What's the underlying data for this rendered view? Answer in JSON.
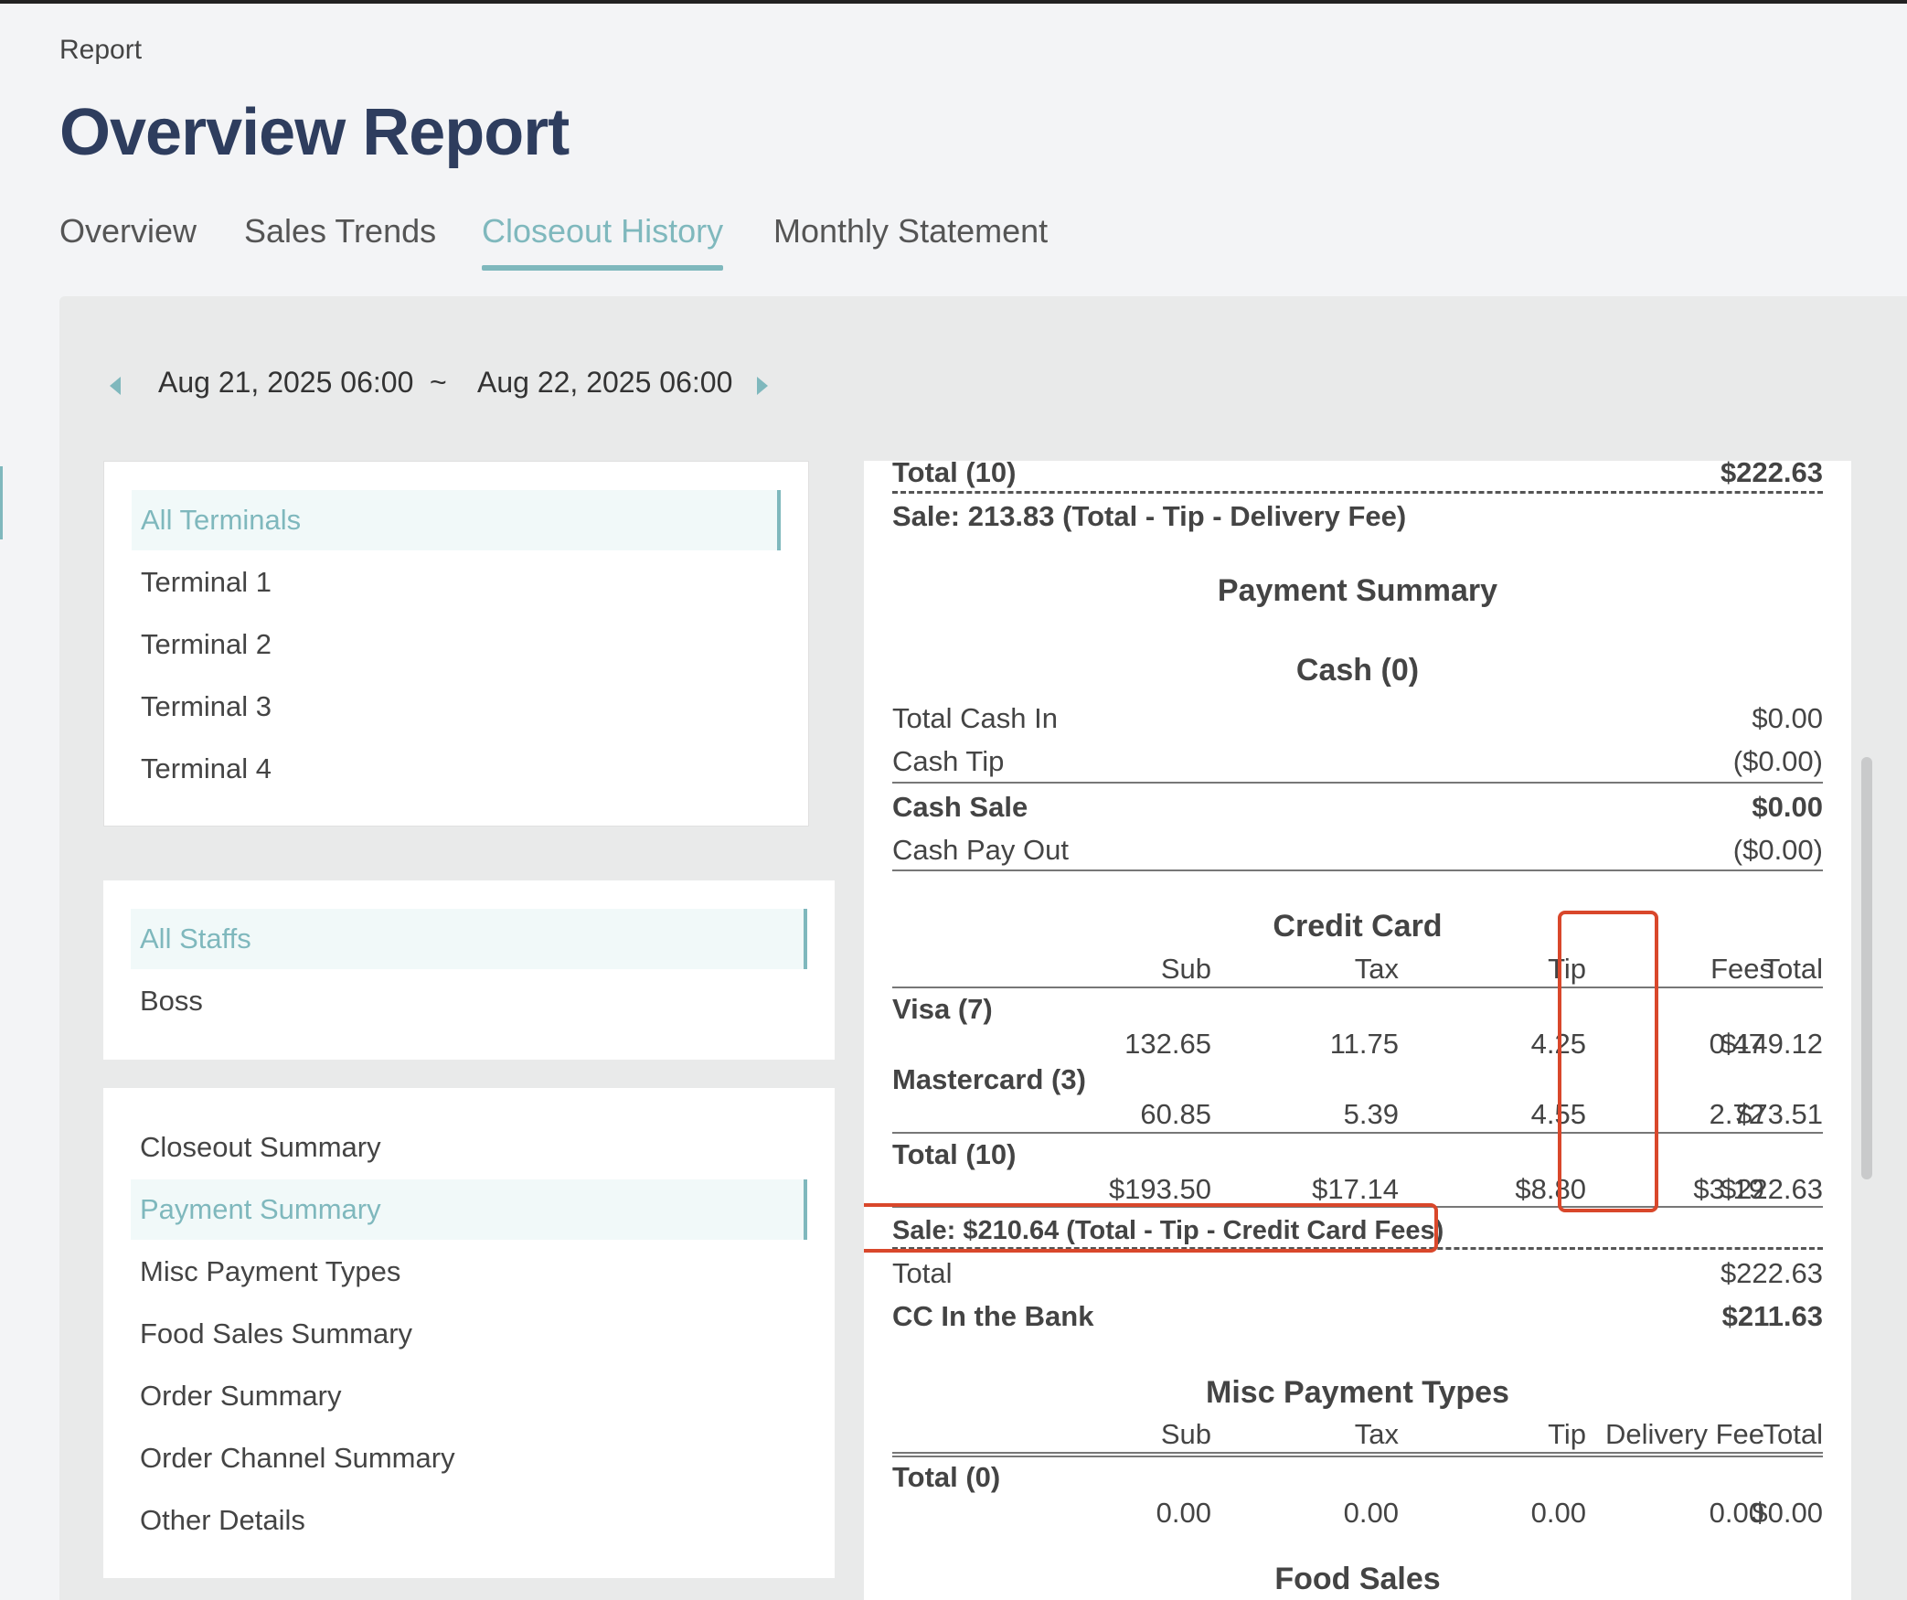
{
  "breadcrumb": "Report",
  "page_title": "Overview Report",
  "tabs": [
    {
      "label": "Overview",
      "active": false
    },
    {
      "label": "Sales Trends",
      "active": false
    },
    {
      "label": "Closeout History",
      "active": true
    },
    {
      "label": "Monthly Statement",
      "active": false
    }
  ],
  "date_range": {
    "start": "Aug 21, 2025 06:00",
    "separator": "~",
    "end": "Aug 22, 2025 06:00"
  },
  "terminals": [
    "All Terminals",
    "Terminal 1",
    "Terminal 2",
    "Terminal 3",
    "Terminal 4"
  ],
  "staffs": [
    "All Staffs",
    "Boss"
  ],
  "sections": [
    "Closeout Summary",
    "Payment Summary",
    "Misc Payment Types",
    "Food Sales Summary",
    "Order Summary",
    "Order Channel Summary",
    "Other Details"
  ],
  "report": {
    "top_total_label": "Total (10)",
    "top_total_value": "$222.63",
    "top_sale_note": "Sale: 213.83 (Total - Tip - Delivery Fee)",
    "payment_summary_title": "Payment Summary",
    "cash": {
      "title": "Cash (0)",
      "total_cash_in_label": "Total Cash In",
      "total_cash_in_value": "$0.00",
      "cash_tip_label": "Cash Tip",
      "cash_tip_value": "($0.00)",
      "cash_sale_label": "Cash Sale",
      "cash_sale_value": "$0.00",
      "cash_pay_out_label": "Cash Pay Out",
      "cash_pay_out_value": "($0.00)"
    },
    "credit_card": {
      "title": "Credit Card",
      "headers": {
        "sub": "Sub",
        "tax": "Tax",
        "tip": "Tip",
        "fees": "Fees",
        "total": "Total"
      },
      "visa": {
        "label": "Visa (7)",
        "sub": "132.65",
        "tax": "11.75",
        "tip": "4.25",
        "fees": "0.47",
        "total": "$149.12"
      },
      "mastercard": {
        "label": "Mastercard (3)",
        "sub": "60.85",
        "tax": "5.39",
        "tip": "4.55",
        "fees": "2.72",
        "total": "$73.51"
      },
      "total": {
        "label": "Total (10)",
        "sub": "$193.50",
        "tax": "$17.14",
        "tip": "$8.80",
        "fees": "$3.19",
        "total": "$222.63"
      },
      "sale_note": "Sale: $210.64 (Total - Tip - Credit Card Fees)",
      "total_label": "Total",
      "total_value": "$222.63",
      "cc_bank_label": "CC In the Bank",
      "cc_bank_value": "$211.63"
    },
    "misc": {
      "title": "Misc Payment Types",
      "headers": {
        "sub": "Sub",
        "tax": "Tax",
        "tip": "Tip",
        "delivery_fee": "Delivery Fee",
        "total": "Total"
      },
      "total": {
        "label": "Total (0)",
        "sub": "0.00",
        "tax": "0.00",
        "tip": "0.00",
        "delivery_fee": "0.00",
        "total": "$0.00"
      }
    },
    "food_sales_title": "Food Sales"
  },
  "colors": {
    "accent": "#7fb8bd",
    "title": "#2e3d5e",
    "highlight": "#d9472b"
  }
}
